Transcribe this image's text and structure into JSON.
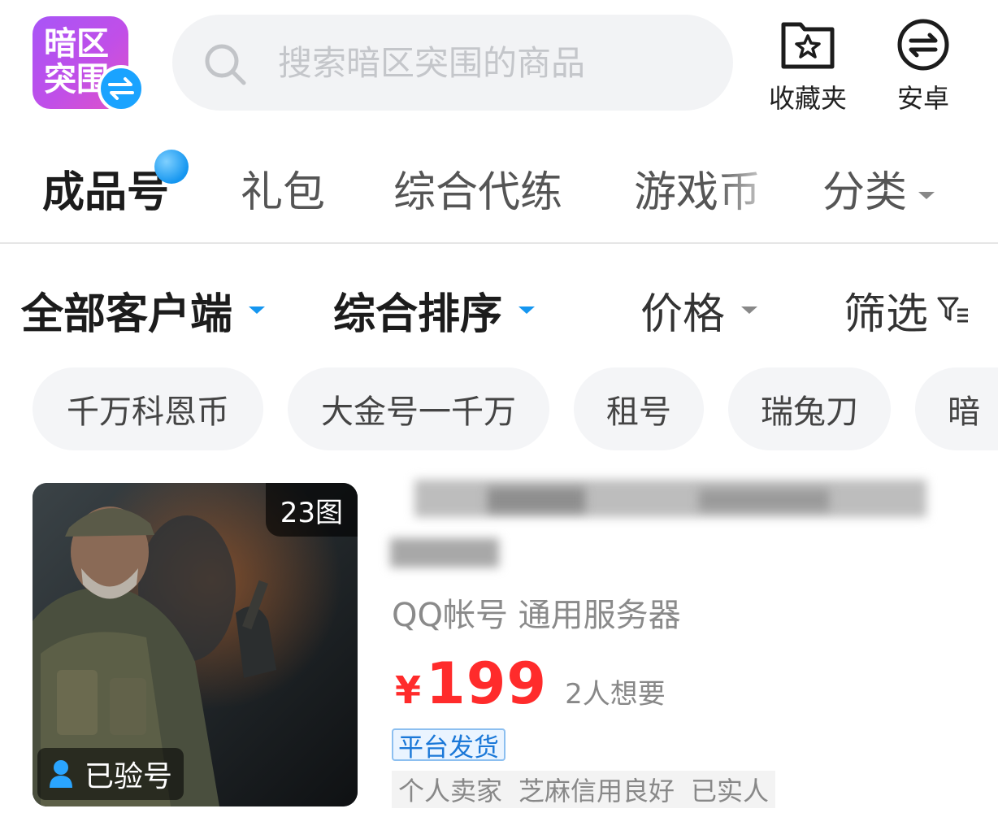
{
  "header": {
    "logo_text": [
      "暗区",
      "突围"
    ],
    "search": {
      "placeholder": "搜索暗区突围的商品",
      "value": ""
    },
    "actions": [
      {
        "label": "收藏夹",
        "icon": "favorites-folder-star-icon"
      },
      {
        "label": "安卓",
        "icon": "android-switch-icon"
      }
    ]
  },
  "category_tabs": [
    {
      "label": "成品号",
      "active": true
    },
    {
      "label": "礼包"
    },
    {
      "label": "综合代练"
    },
    {
      "label": "游戏币"
    },
    {
      "label": "分类",
      "has_dropdown": true
    }
  ],
  "filter_bar": [
    {
      "label": "全部客户端",
      "dropdown": true
    },
    {
      "label": "综合排序",
      "dropdown": true
    },
    {
      "label": "价格",
      "dropdown": true
    },
    {
      "label": "筛选",
      "icon": "filter-icon"
    }
  ],
  "tag_chips": [
    "千万科恩币",
    "大金号一千万",
    "租号",
    "瑞兔刀",
    "暗"
  ],
  "product": {
    "image_count": "23图",
    "verified_label": "已验号",
    "subtitle": "QQ帐号 通用服务器",
    "price_currency": "¥",
    "price_value": "199",
    "want_count": "2人想要",
    "delivery_tag": "平台发货",
    "seller_tags": [
      "个人卖家",
      "芝麻信用良好",
      "已实人"
    ]
  },
  "colors": {
    "accent_blue": "#1596f0",
    "price_red": "#ff2b2b",
    "logo_purple": "#b34ff0"
  }
}
